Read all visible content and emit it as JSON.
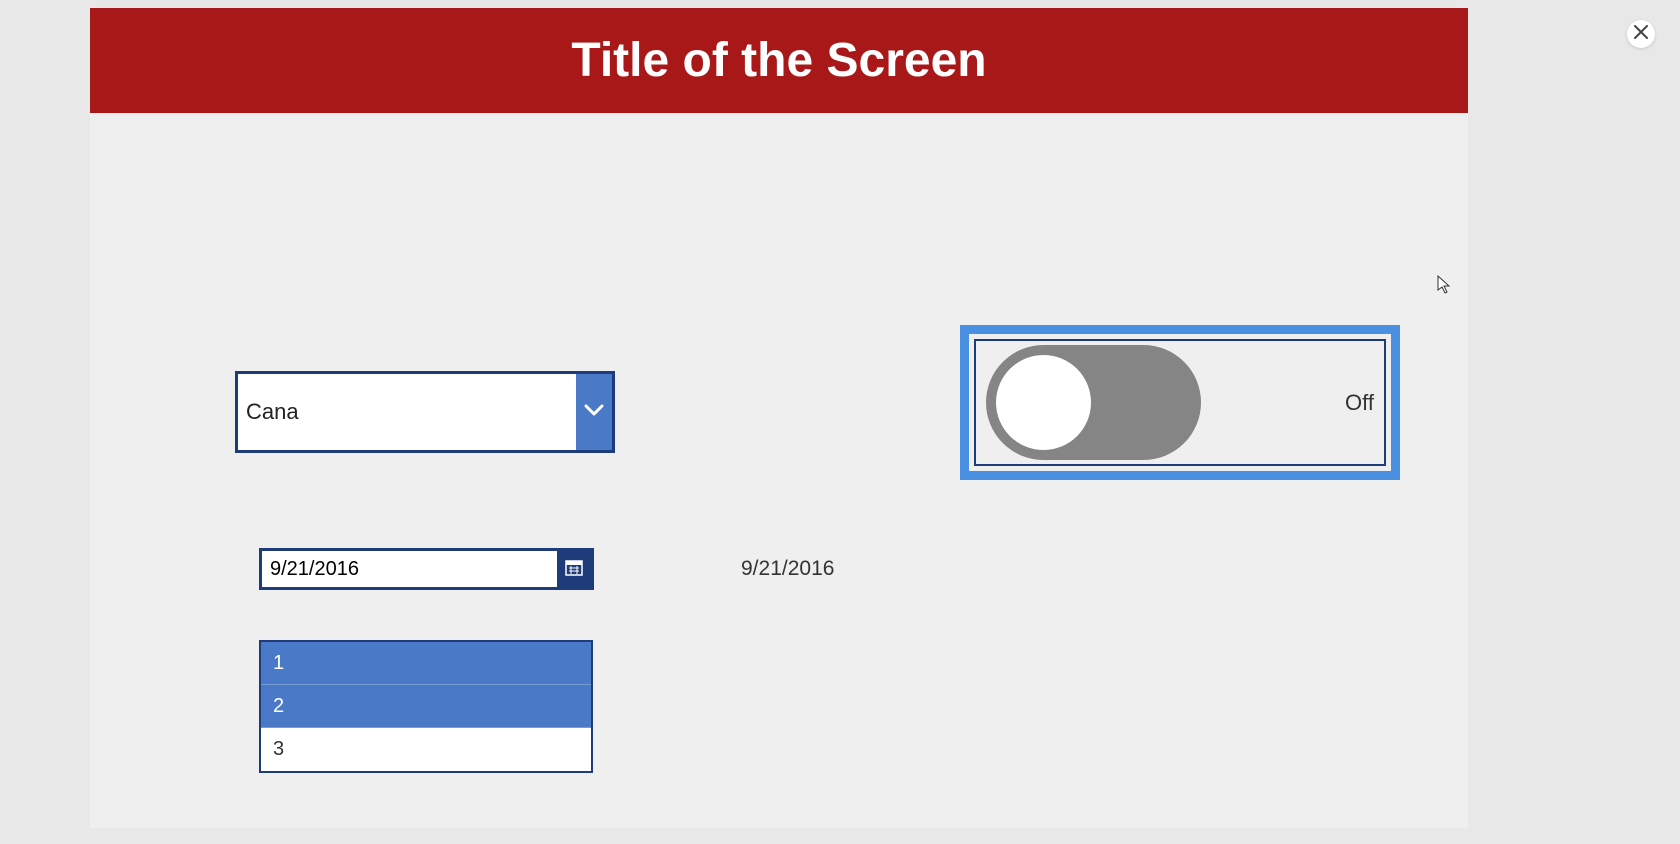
{
  "header": {
    "title": "Title of the Screen"
  },
  "combobox": {
    "value": "Cana"
  },
  "datepicker": {
    "value": "9/21/2016"
  },
  "date_display": "9/21/2016",
  "toggle": {
    "state_label": "Off"
  },
  "listbox": {
    "items": [
      {
        "label": "1",
        "selected": true
      },
      {
        "label": "2",
        "selected": true
      },
      {
        "label": "3",
        "selected": false
      }
    ]
  }
}
